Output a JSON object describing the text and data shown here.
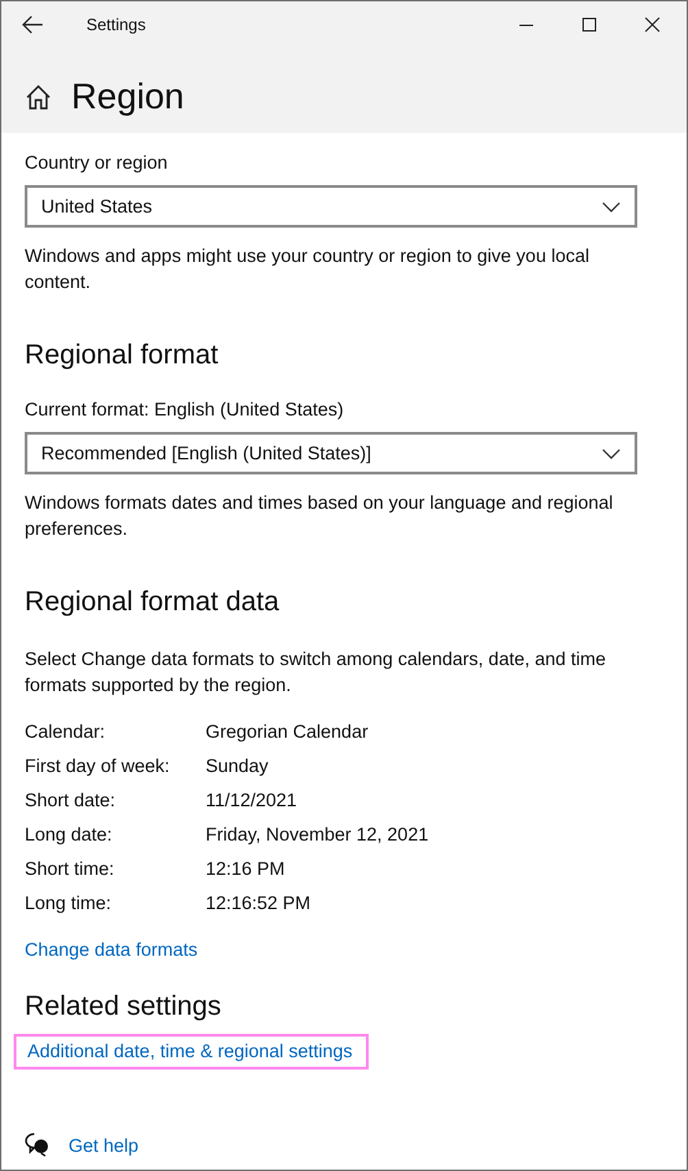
{
  "window": {
    "title": "Settings"
  },
  "page": {
    "title": "Region"
  },
  "country": {
    "label": "Country or region",
    "value": "United States",
    "description": "Windows and apps might use your country or region to give you local content."
  },
  "regional_format": {
    "heading": "Regional format",
    "current": "Current format: English (United States)",
    "value": "Recommended [English (United States)]",
    "description": "Windows formats dates and times based on your language and regional preferences."
  },
  "format_data": {
    "heading": "Regional format data",
    "description": "Select Change data formats to switch among calendars, date, and time formats supported by the region.",
    "rows": [
      {
        "label": "Calendar:",
        "value": "Gregorian Calendar"
      },
      {
        "label": "First day of week:",
        "value": "Sunday"
      },
      {
        "label": "Short date:",
        "value": "11/12/2021"
      },
      {
        "label": "Long date:",
        "value": "Friday, November 12, 2021"
      },
      {
        "label": "Short time:",
        "value": "12:16 PM"
      },
      {
        "label": "Long time:",
        "value": "12:16:52 PM"
      }
    ],
    "link": "Change data formats"
  },
  "related": {
    "heading": "Related settings",
    "links": [
      {
        "text": "Additional date, time & regional settings",
        "highlighted": true
      }
    ]
  },
  "help": {
    "text": "Get help"
  }
}
